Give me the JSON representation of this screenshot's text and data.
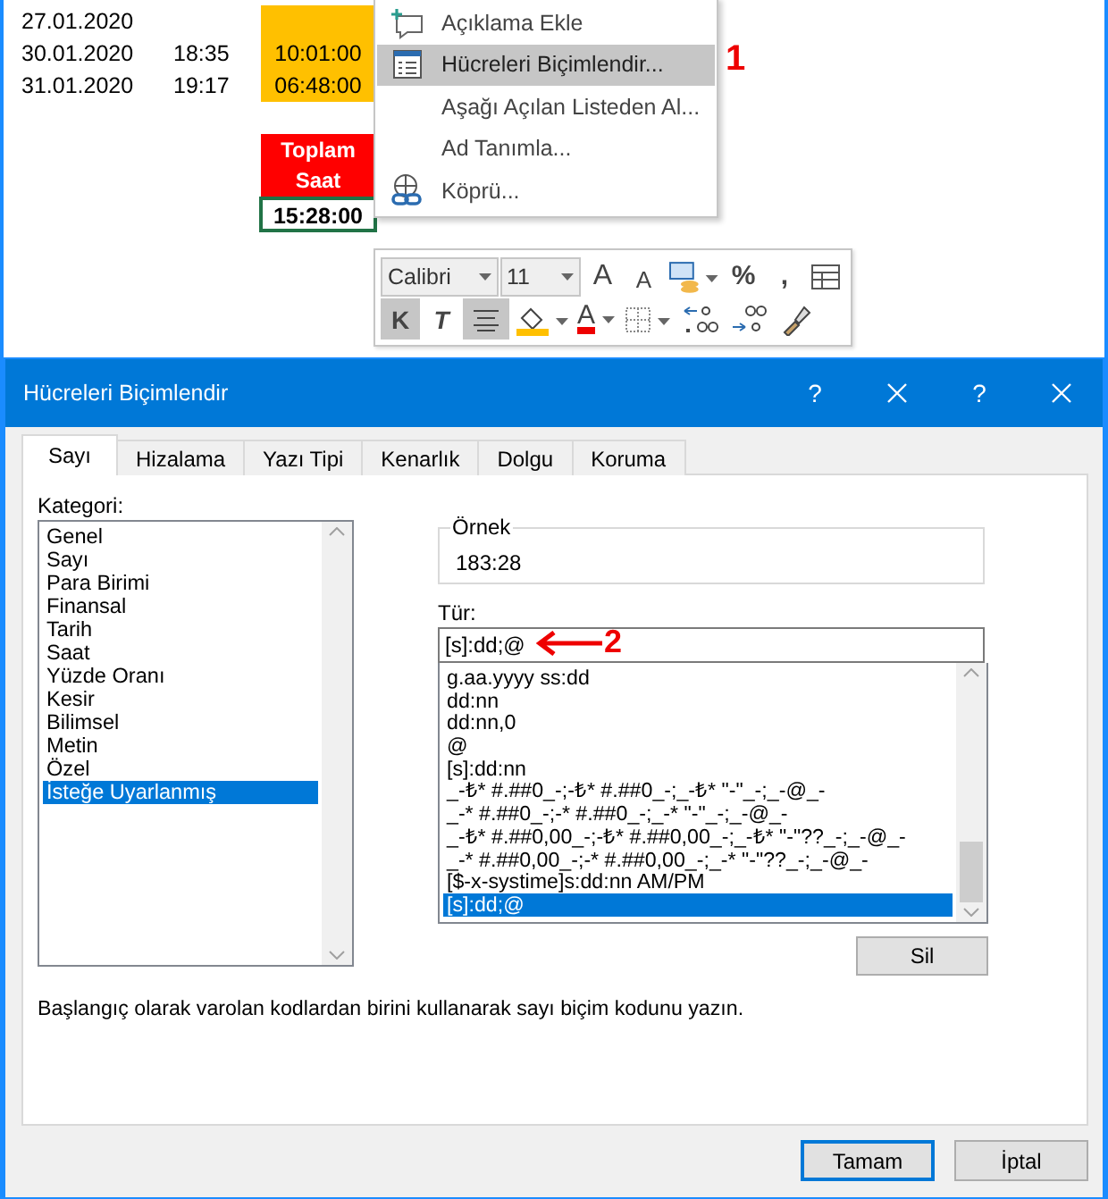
{
  "sheet": {
    "rows": [
      {
        "cells": [
          "27.01.2020"
        ]
      },
      {
        "cells": [
          "30.01.2020",
          "18:35",
          "10:01:00"
        ]
      },
      {
        "cells": [
          "31.01.2020",
          "19:17",
          "06:48:00"
        ]
      }
    ],
    "total_header": "Toplam Saat",
    "total_cells": [
      {
        "value": "15:28:00",
        "selected": true
      }
    ]
  },
  "context_menu": {
    "items": [
      {
        "label": "Açıklama Ekle",
        "kind": "comment",
        "selected": false
      },
      {
        "label": "Hücreleri Biçimlendir...",
        "kind": "format",
        "selected": true
      },
      {
        "label": "Aşağı Açılan Listeden Al...",
        "kind": "plain",
        "selected": false
      },
      {
        "label": "Ad Tanımla...",
        "kind": "plain",
        "selected": false
      },
      {
        "label": "Köprü...",
        "kind": "link",
        "selected": false
      }
    ],
    "annotation": "1"
  },
  "mini_toolbar": {
    "font_controls": [
      {
        "kind": "font",
        "label": "Calibri"
      },
      {
        "kind": "size",
        "label": "11"
      },
      {
        "kind": "grow",
        "label": "A",
        "selected": false
      },
      {
        "kind": "shrink",
        "label": "A",
        "selected": false
      },
      {
        "kind": "currency",
        "selected": false
      },
      {
        "kind": "text",
        "label": "%",
        "selected": false
      },
      {
        "kind": "text",
        "label": ",",
        "selected": false
      },
      {
        "kind": "table",
        "selected": false
      }
    ],
    "format_buttons": [
      {
        "kind": "bold",
        "label": "K",
        "selected": true
      },
      {
        "kind": "italic",
        "label": "T",
        "selected": false
      },
      {
        "kind": "center",
        "selected": true
      },
      {
        "kind": "fill",
        "selected": false
      },
      {
        "kind": "fontcolor",
        "label": "A",
        "selected": false
      },
      {
        "kind": "borders",
        "selected": false
      },
      {
        "kind": "incdec",
        "selected": false
      },
      {
        "kind": "decdec",
        "selected": false
      },
      {
        "kind": "painter",
        "selected": false
      }
    ]
  },
  "dialog": {
    "title": "Hücreleri Biçimlendir",
    "title_buttons": [
      {
        "kind": "help",
        "label": "?"
      },
      {
        "kind": "close"
      },
      {
        "kind": "help",
        "label": "?"
      },
      {
        "kind": "close"
      }
    ],
    "tabs": [
      {
        "label": "Sayı",
        "selected": true
      },
      {
        "label": "Hizalama",
        "selected": false
      },
      {
        "label": "Yazı Tipi",
        "selected": false
      },
      {
        "label": "Kenarlık",
        "selected": false
      },
      {
        "label": "Dolgu",
        "selected": false
      },
      {
        "label": "Koruma",
        "selected": false
      }
    ],
    "category_label": "Kategori:",
    "categories": [
      {
        "label": "Genel",
        "selected": false
      },
      {
        "label": "Sayı",
        "selected": false
      },
      {
        "label": "Para Birimi",
        "selected": false
      },
      {
        "label": "Finansal",
        "selected": false
      },
      {
        "label": "Tarih",
        "selected": false
      },
      {
        "label": "Saat",
        "selected": false
      },
      {
        "label": "Yüzde Oranı",
        "selected": false
      },
      {
        "label": "Kesir",
        "selected": false
      },
      {
        "label": "Bilimsel",
        "selected": false
      },
      {
        "label": "Metin",
        "selected": false
      },
      {
        "label": "Özel",
        "selected": false
      },
      {
        "label": "İsteğe Uyarlanmış",
        "selected": true
      }
    ],
    "sample": {
      "label": "Örnek",
      "value": "183:28"
    },
    "type_label": "Tür:",
    "type_value": "[s]:dd;@",
    "type_annotation": "2",
    "types": [
      {
        "label": "g.aa.yyyy ss:dd",
        "selected": false
      },
      {
        "label": "dd:nn",
        "selected": false
      },
      {
        "label": "dd:nn,0",
        "selected": false
      },
      {
        "label": "@",
        "selected": false
      },
      {
        "label": "[s]:dd:nn",
        "selected": false
      },
      {
        "label": "_-₺* #.##0_-;-₺* #.##0_-;_-₺* \"-\"_-;_-@_-",
        "selected": false
      },
      {
        "label": "_-* #.##0_-;-* #.##0_-;_-* \"-\"_-;_-@_-",
        "selected": false
      },
      {
        "label": "_-₺* #.##0,00_-;-₺* #.##0,00_-;_-₺* \"-\"??_-;_-@_-",
        "selected": false
      },
      {
        "label": "_-* #.##0,00_-;-* #.##0,00_-;_-* \"-\"??_-;_-@_-",
        "selected": false
      },
      {
        "label": "[$-x-systime]s:dd:nn AM/PM",
        "selected": false
      },
      {
        "label": "[s]:dd;@",
        "selected": true
      }
    ],
    "delete_button": "Sil",
    "description": "Başlangıç olarak varolan kodlardan birini kullanarak sayı biçim kodunu yazın.",
    "buttons": [
      {
        "label": "Tamam",
        "default": true
      },
      {
        "label": "İptal",
        "default": false
      }
    ]
  }
}
